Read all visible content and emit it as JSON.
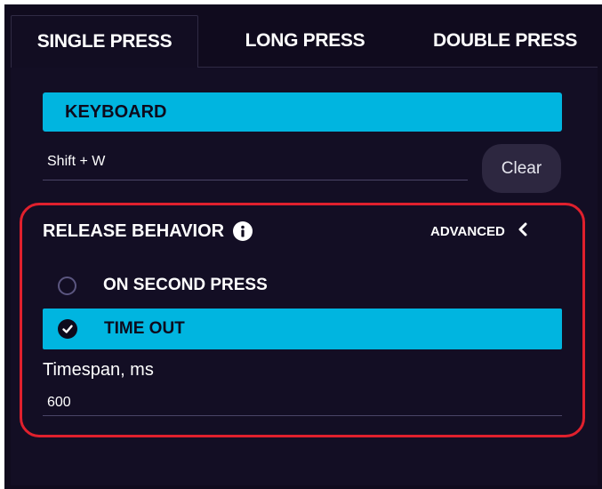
{
  "tabs": [
    {
      "label": "SINGLE PRESS",
      "active": true
    },
    {
      "label": "LONG PRESS",
      "active": false
    },
    {
      "label": "DOUBLE PRESS",
      "active": false
    }
  ],
  "action_type": {
    "label": "KEYBOARD"
  },
  "shortcut": {
    "value": "Shift + W"
  },
  "clear_button": {
    "label": "Clear"
  },
  "release_behavior": {
    "title": "RELEASE BEHAVIOR",
    "info_icon": "info-icon",
    "advanced_label": "ADVANCED",
    "options": [
      {
        "label": "ON SECOND PRESS",
        "selected": false
      },
      {
        "label": "TIME OUT",
        "selected": true
      }
    ],
    "timespan": {
      "label": "Timespan, ms",
      "value": "600"
    }
  },
  "colors": {
    "accent": "#00b5e0",
    "background": "#100b1e",
    "highlight_border": "#e0202d"
  }
}
